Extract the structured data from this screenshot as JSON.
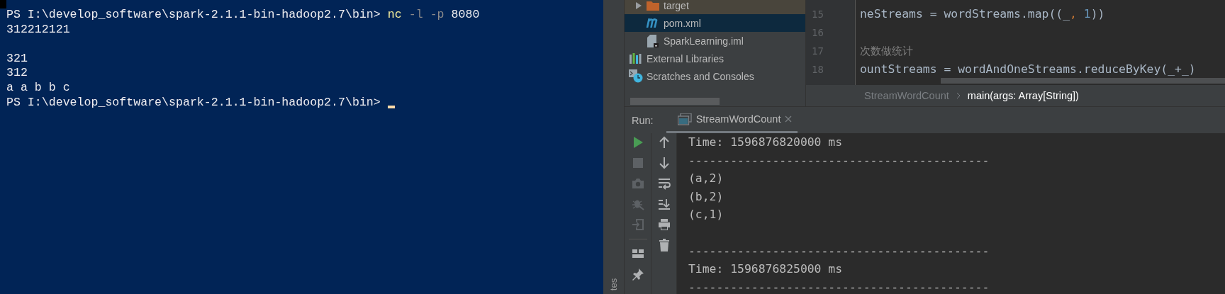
{
  "terminal": {
    "lines": [
      {
        "tokens": [
          {
            "text": "PS I:\\develop_software\\spark-2.1.1-bin-hadoop2.7\\bin>",
            "kind": "prompt"
          },
          {
            "text": "nc",
            "kind": "command"
          },
          {
            "text": "-l",
            "kind": "flag"
          },
          {
            "text": "-p",
            "kind": "flag"
          },
          {
            "text": "8080",
            "kind": "arg"
          }
        ]
      },
      {
        "tokens": [
          {
            "text": "312212121",
            "kind": "output"
          }
        ]
      },
      {
        "kind": "blank"
      },
      {
        "tokens": [
          {
            "text": "321",
            "kind": "output"
          }
        ]
      },
      {
        "tokens": [
          {
            "text": "312",
            "kind": "output"
          }
        ]
      },
      {
        "tokens": [
          {
            "text": "a a b b c",
            "kind": "output"
          }
        ]
      },
      {
        "tokens": [
          {
            "text": "PS I:\\develop_software\\spark-2.1.1-bin-hadoop2.7\\bin>",
            "kind": "prompt"
          }
        ],
        "cursor": true
      }
    ]
  },
  "project_tree": {
    "module_children": [
      {
        "label": "target",
        "kind": "folder",
        "tinted": true,
        "selected": false
      },
      {
        "label": "pom.xml",
        "kind": "maven",
        "selected": true
      },
      {
        "label": "SparkLearning.iml",
        "kind": "iml",
        "tinted": false,
        "selected": false
      }
    ],
    "roots": [
      {
        "label": "External Libraries",
        "kind": "libraries",
        "selected": false
      },
      {
        "label": "Scratches and Consoles",
        "kind": "scratches",
        "selected": false
      }
    ]
  },
  "editor": {
    "lines": [
      {
        "number": "15",
        "tokens": [
          {
            "text": "neStreams = wordStreams.map((_",
            "kind": "plain"
          },
          {
            "text": ", ",
            "kind": "keyword"
          },
          {
            "text": "1",
            "kind": "number"
          },
          {
            "text": "))",
            "kind": "plain"
          }
        ]
      },
      {
        "number": "16"
      },
      {
        "number": "17",
        "tokens": [
          {
            "text": "次数做统计",
            "kind": "comment"
          }
        ]
      },
      {
        "number": "18",
        "tokens": [
          {
            "text": "ountStreams = wordAndOneStreams.reduceByKey(_+_)",
            "kind": "plain"
          }
        ]
      }
    ],
    "breadcrumbs": [
      {
        "label": "StreamWordCount",
        "current": false
      },
      {
        "label": "main(args: Array[String])",
        "current": true
      }
    ]
  },
  "side_strip": {
    "label": "tes"
  },
  "run": {
    "title": "Run:",
    "tabs": [
      {
        "label": "StreamWordCount",
        "selected": true
      }
    ],
    "left_tools": [
      {
        "kind": "run",
        "disabled": false
      },
      {
        "kind": "stop",
        "disabled": true
      },
      {
        "kind": "camera",
        "disabled": true
      },
      {
        "kind": "bug",
        "disabled": true
      },
      {
        "kind": "exit",
        "disabled": true
      },
      {
        "kind": "layout",
        "disabled": false
      },
      {
        "kind": "pin",
        "disabled": false
      }
    ],
    "right_tools": [
      {
        "kind": "up",
        "disabled": false
      },
      {
        "kind": "down",
        "disabled": false
      },
      {
        "kind": "wrap",
        "disabled": false
      },
      {
        "kind": "scroll-end",
        "disabled": false
      },
      {
        "kind": "print",
        "disabled": false
      },
      {
        "kind": "trash",
        "disabled": false
      }
    ],
    "output": [
      {
        "text": "Time: 1596876820000 ms"
      },
      {
        "text": "-------------------------------------------"
      },
      {
        "text": "(a,2)"
      },
      {
        "text": "(b,2)"
      },
      {
        "text": "(c,1)"
      },
      {
        "kind": "blank"
      },
      {
        "text": "-------------------------------------------"
      },
      {
        "text": "Time: 1596876825000 ms"
      },
      {
        "text": "-------------------------------------------"
      }
    ]
  }
}
